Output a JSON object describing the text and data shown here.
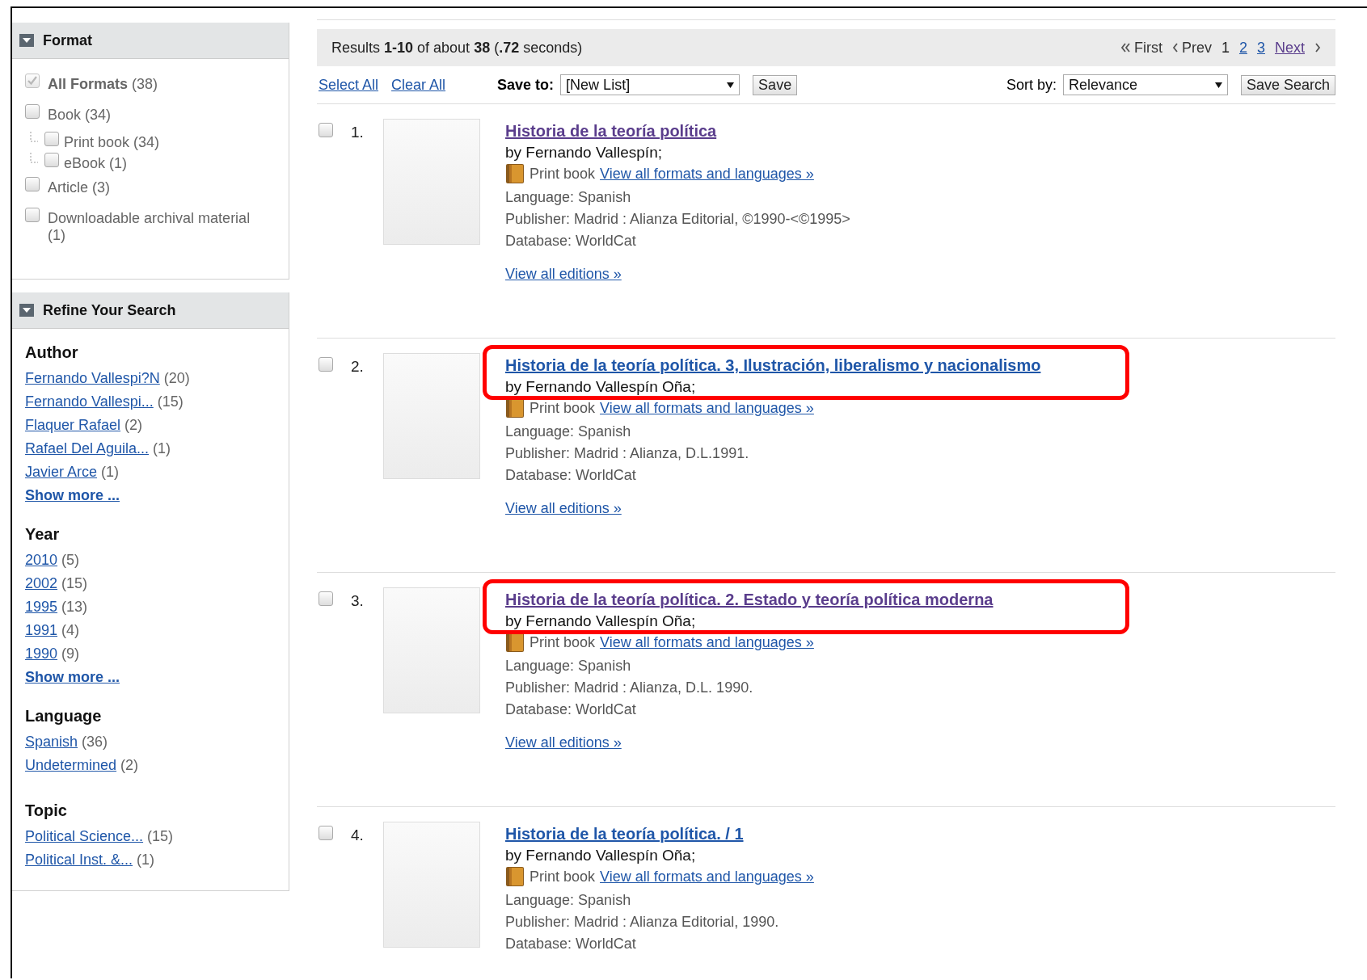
{
  "format_panel": {
    "title": "Format",
    "expanded": true,
    "items": [
      {
        "label": "All Formats",
        "count": "(38)",
        "checked": true,
        "disabled": true
      },
      {
        "label": "Book",
        "count": "(34)",
        "checked": false,
        "disabled": false,
        "children": [
          {
            "label": "Print book",
            "count": "(34)",
            "checked": false,
            "disabled": false
          },
          {
            "label": "eBook",
            "count": "(1)",
            "checked": false,
            "disabled": false
          }
        ]
      },
      {
        "label": "Article",
        "count": "(3)",
        "checked": false,
        "disabled": false
      },
      {
        "label": "Downloadable archival material",
        "count": "(1)",
        "checked": false,
        "disabled": false
      }
    ]
  },
  "refine_panel": {
    "title": "Refine Your Search",
    "expanded": true,
    "groups": [
      {
        "heading": "Author",
        "links": [
          {
            "label": "Fernando Vallespi?N",
            "count": "(20)"
          },
          {
            "label": "Fernando Vallespi...",
            "count": "(15)"
          },
          {
            "label": "Flaquer Rafael",
            "count": "(2)"
          },
          {
            "label": "Rafael Del Aguila...",
            "count": "(1)"
          },
          {
            "label": "Javier Arce",
            "count": "(1)"
          }
        ],
        "more": "Show more ..."
      },
      {
        "heading": "Year",
        "links": [
          {
            "label": "2010",
            "count": "(5)"
          },
          {
            "label": "2002",
            "count": "(15)"
          },
          {
            "label": "1995",
            "count": "(13)"
          },
          {
            "label": "1991",
            "count": "(4)"
          },
          {
            "label": "1990",
            "count": "(9)"
          }
        ],
        "more": "Show more ..."
      },
      {
        "heading": "Language",
        "links": [
          {
            "label": "Spanish",
            "count": "(36)"
          },
          {
            "label": "Undetermined",
            "count": "(2)"
          }
        ]
      },
      {
        "heading": "Topic",
        "links": [
          {
            "label": "Political Science...",
            "count": "(15)"
          },
          {
            "label": "Political Inst. &...",
            "count": "(1)"
          }
        ]
      }
    ]
  },
  "results_bar": {
    "summary": "Results **1-10** of about **38** (**.72** seconds)",
    "first": "First",
    "prev": "Prev",
    "pages": [
      {
        "label": "1",
        "selected": true
      },
      {
        "label": "2",
        "selected": false
      },
      {
        "label": "3",
        "selected": false
      }
    ],
    "next": "Next"
  },
  "toolbar": {
    "select_all": "Select All",
    "clear_all": "Clear All",
    "save_to_label": "Save to:",
    "save_to_value": "[New List]",
    "save_button": "Save",
    "sort_label": "Sort by:",
    "sort_value": "Relevance",
    "save_search_button": "Save Search"
  },
  "results": [
    {
      "number": "1.",
      "checked": false,
      "title": "Historia de la teoría política",
      "visited": true,
      "highlighted": false,
      "author": "by Fernando Vallespín;",
      "format": "Print book",
      "formats_link": "View all formats and languages »",
      "language": "Language: Spanish",
      "publisher": "Publisher: Madrid : Alianza Editorial, ©1990-<©1995>",
      "database": "Database: WorldCat",
      "editions_link": "View all editions »"
    },
    {
      "number": "2.",
      "checked": false,
      "title": "Historia de la teoría política. 3, Ilustración, liberalismo y nacionalismo",
      "visited": false,
      "highlighted": true,
      "author": "by Fernando Vallespín Oña;",
      "format": "Print book",
      "formats_link": "View all formats and languages »",
      "language": "Language: Spanish",
      "publisher": "Publisher: Madrid : Alianza, D.L.1991.",
      "database": "Database: WorldCat",
      "editions_link": "View all editions »"
    },
    {
      "number": "3.",
      "checked": false,
      "title": "Historia de la teoría política. 2. Estado y teoría política moderna",
      "visited": true,
      "highlighted": true,
      "author": "by Fernando Vallespín Oña;",
      "format": "Print book",
      "formats_link": "View all formats and languages »",
      "language": "Language: Spanish",
      "publisher": "Publisher: Madrid : Alianza, D.L. 1990.",
      "database": "Database: WorldCat",
      "editions_link": "View all editions »"
    },
    {
      "number": "4.",
      "checked": false,
      "title": "Historia de la teoría política. / 1",
      "visited": false,
      "highlighted": false,
      "author": "by Fernando Vallespín Oña;",
      "format": "Print book",
      "formats_link": "View all formats and languages »",
      "language": "Language: Spanish",
      "publisher": "Publisher: Madrid : Alianza Editorial, 1990.",
      "database": "Database: WorldCat"
    }
  ]
}
